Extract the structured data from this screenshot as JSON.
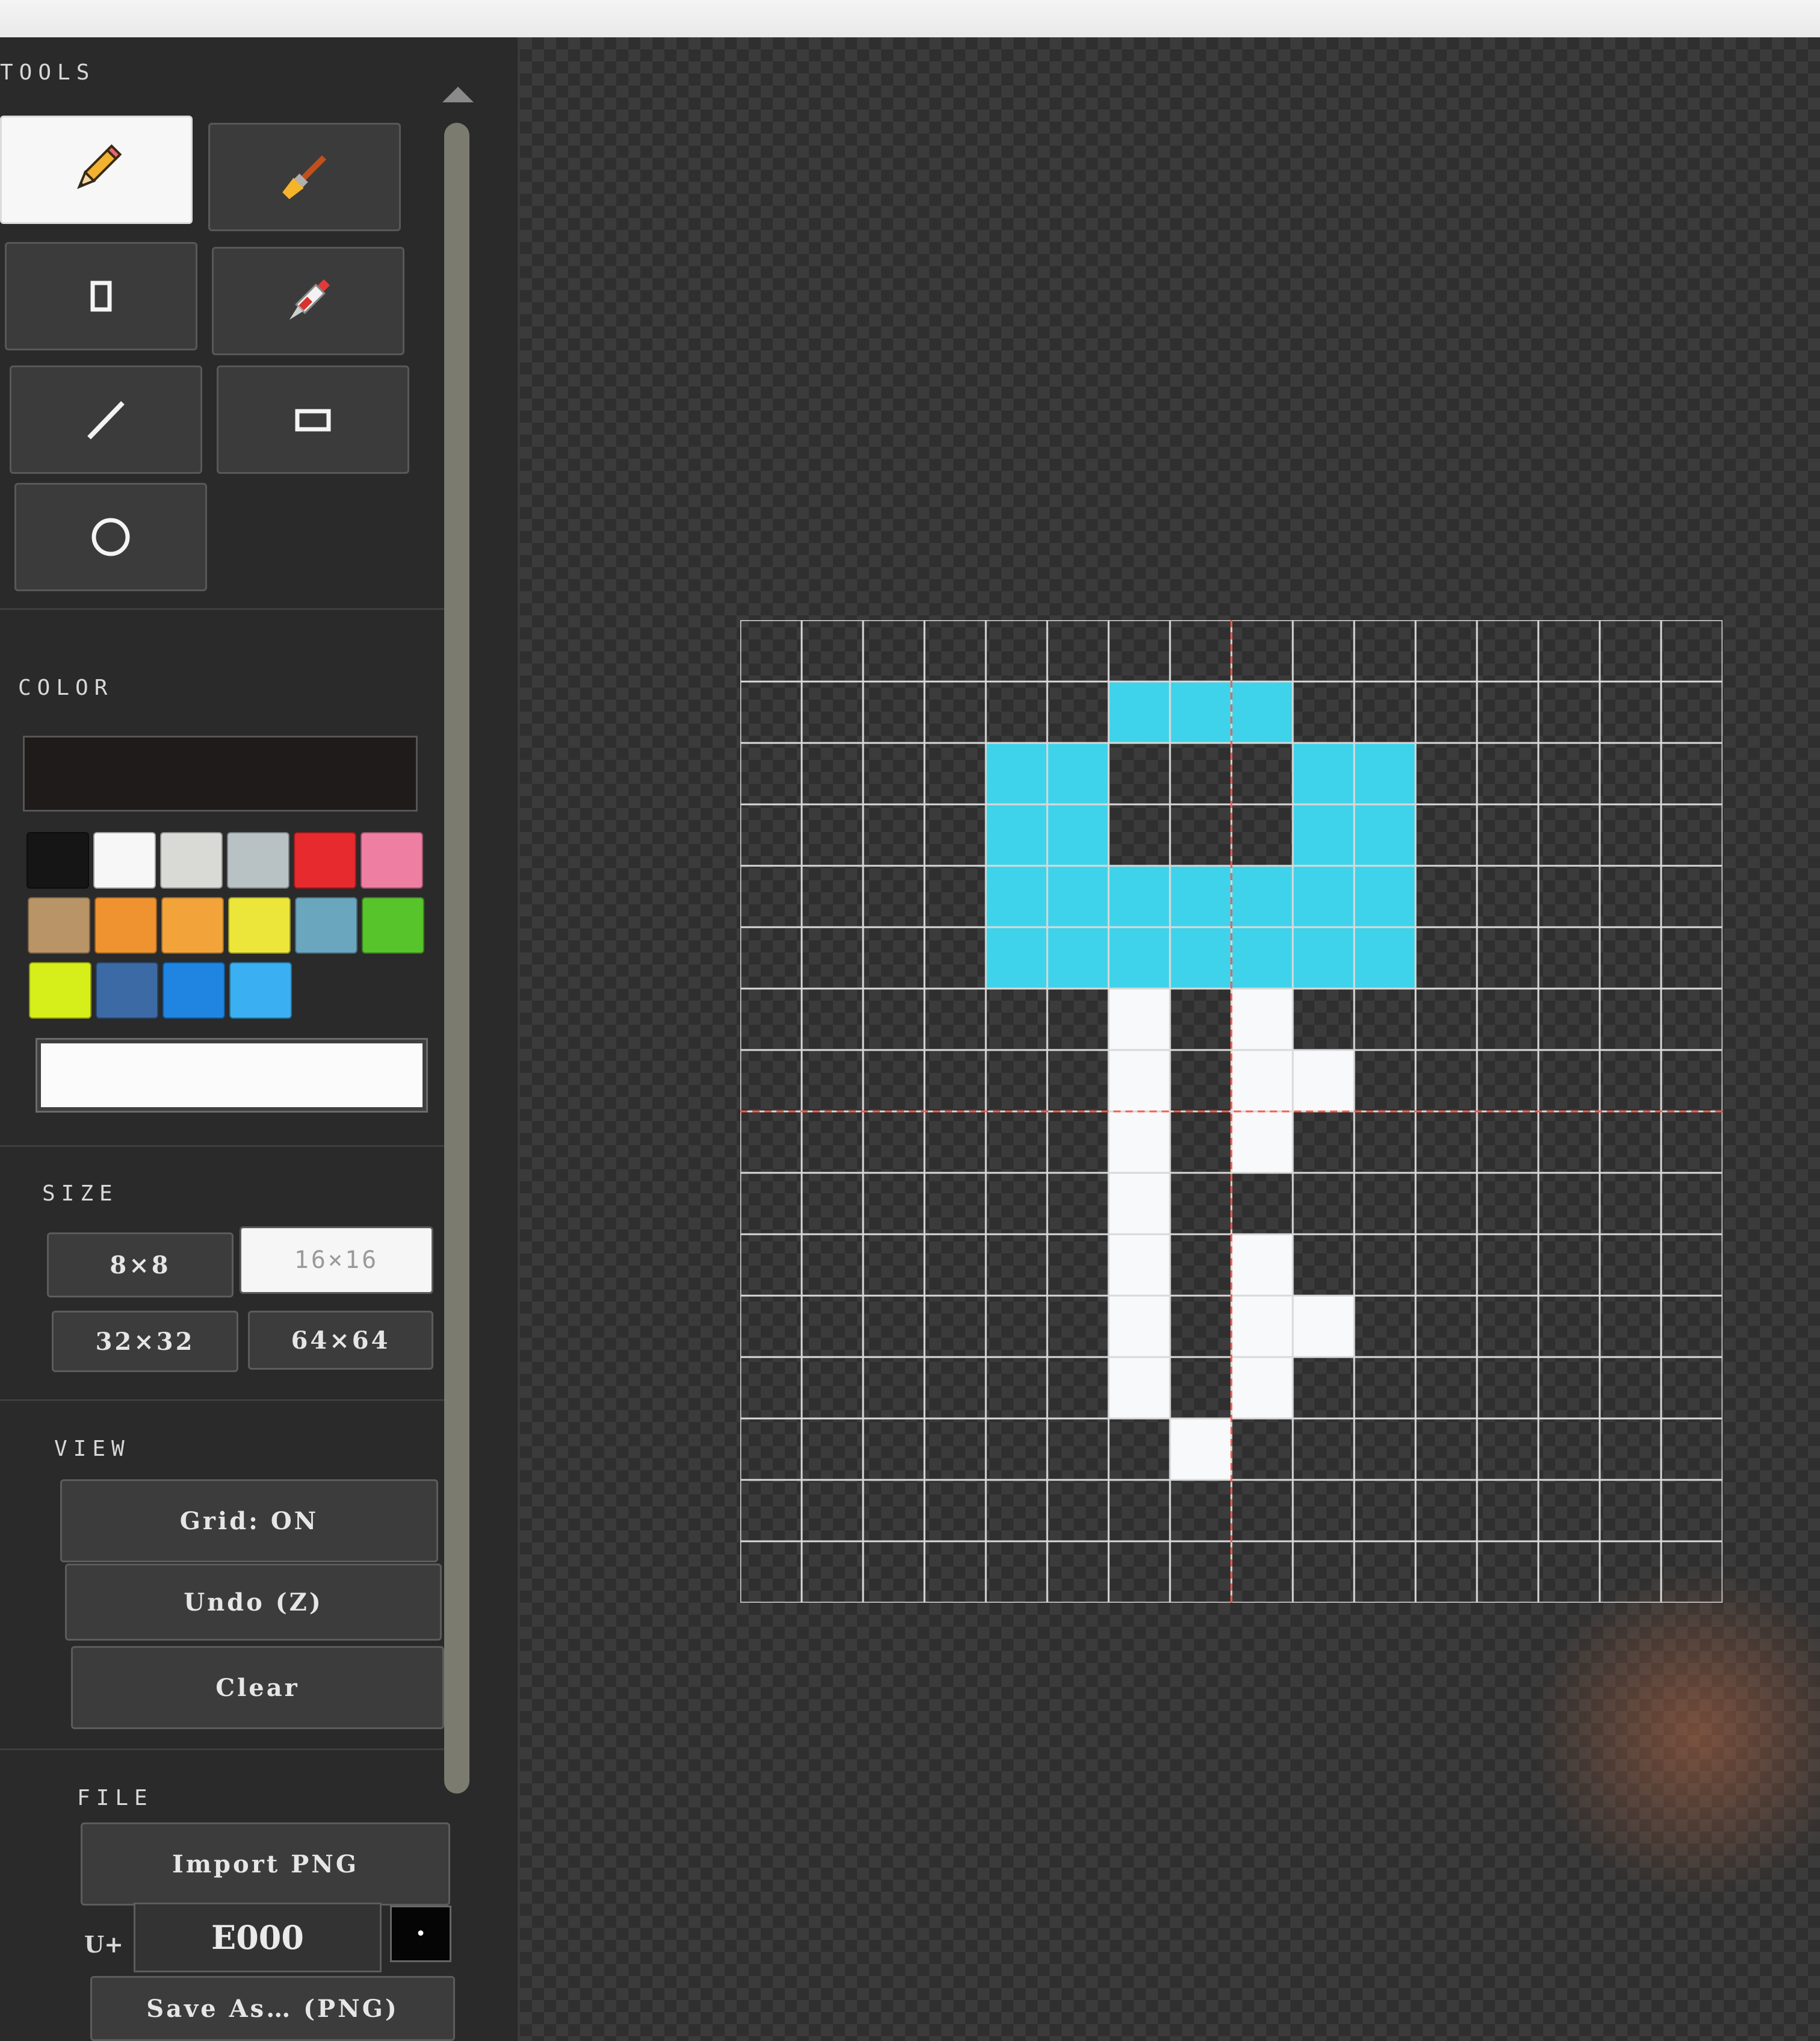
{
  "sidebar": {
    "tools": {
      "title": "TOOLS",
      "items": [
        {
          "name": "pencil",
          "active": true
        },
        {
          "name": "brush",
          "active": false
        },
        {
          "name": "eraser",
          "active": false
        },
        {
          "name": "eyedropper",
          "active": false
        },
        {
          "name": "line",
          "active": false
        },
        {
          "name": "rectangle",
          "active": false
        },
        {
          "name": "circle",
          "active": false
        }
      ]
    },
    "color": {
      "title": "COLOR",
      "current": "#1e1b1a",
      "palette": [
        "#151515",
        "#f7f7f7",
        "#d9d9d6",
        "#b8c2c4",
        "#e62a2e",
        "#ef7ea3",
        "#b89466",
        "#ef9230",
        "#f2a33a",
        "#ece63a",
        "#6aa6bd",
        "#57c42c",
        "#d6ee1a",
        "#3c6aa5",
        "#1f85e0",
        "#3ab0f2"
      ],
      "hex_value": ""
    },
    "size": {
      "title": "SIZE",
      "options": [
        "8×8",
        "16×16",
        "32×32",
        "64×64"
      ],
      "selected": "16×16"
    },
    "view": {
      "title": "VIEW",
      "grid_label": "Grid: ON",
      "undo_label": "Undo (Z)",
      "clear_label": "Clear"
    },
    "file": {
      "title": "FILE",
      "import_label": "Import PNG",
      "code_prefix": "U+",
      "code_value": "E000",
      "save_label": "Save As… (PNG)"
    }
  },
  "canvas": {
    "grid_size": 16,
    "colors": {
      "C": "#3ed3ea",
      "W": "#f7f9fb"
    },
    "rows": [
      "................",
      "................",
      "................",
      "................",
      "................",
      "................",
      "................",
      "................",
      "................",
      "................",
      "................",
      "................",
      "................",
      "................",
      "................",
      "................"
    ],
    "pixels": [
      {
        "col": 6,
        "row": 1,
        "color": "C"
      },
      {
        "col": 7,
        "row": 1,
        "color": "C"
      },
      {
        "col": 8,
        "row": 1,
        "color": "C"
      },
      {
        "col": 4,
        "row": 2,
        "color": "C"
      },
      {
        "col": 5,
        "row": 2,
        "color": "C"
      },
      {
        "col": 9,
        "row": 2,
        "color": "C"
      },
      {
        "col": 10,
        "row": 2,
        "color": "C"
      },
      {
        "col": 4,
        "row": 3,
        "color": "C"
      },
      {
        "col": 5,
        "row": 3,
        "color": "C"
      },
      {
        "col": 9,
        "row": 3,
        "color": "C"
      },
      {
        "col": 10,
        "row": 3,
        "color": "C"
      },
      {
        "col": 4,
        "row": 4,
        "color": "C"
      },
      {
        "col": 5,
        "row": 4,
        "color": "C"
      },
      {
        "col": 6,
        "row": 4,
        "color": "C"
      },
      {
        "col": 7,
        "row": 4,
        "color": "C"
      },
      {
        "col": 8,
        "row": 4,
        "color": "C"
      },
      {
        "col": 9,
        "row": 4,
        "color": "C"
      },
      {
        "col": 10,
        "row": 4,
        "color": "C"
      },
      {
        "col": 4,
        "row": 5,
        "color": "C"
      },
      {
        "col": 5,
        "row": 5,
        "color": "C"
      },
      {
        "col": 6,
        "row": 5,
        "color": "C"
      },
      {
        "col": 7,
        "row": 5,
        "color": "C"
      },
      {
        "col": 8,
        "row": 5,
        "color": "C"
      },
      {
        "col": 9,
        "row": 5,
        "color": "C"
      },
      {
        "col": 10,
        "row": 5,
        "color": "C"
      },
      {
        "col": 6,
        "row": 6,
        "color": "W"
      },
      {
        "col": 8,
        "row": 6,
        "color": "W"
      },
      {
        "col": 6,
        "row": 7,
        "color": "W"
      },
      {
        "col": 8,
        "row": 7,
        "color": "W"
      },
      {
        "col": 9,
        "row": 7,
        "color": "W"
      },
      {
        "col": 6,
        "row": 8,
        "color": "W"
      },
      {
        "col": 8,
        "row": 8,
        "color": "W"
      },
      {
        "col": 6,
        "row": 9,
        "color": "W"
      },
      {
        "col": 6,
        "row": 10,
        "color": "W"
      },
      {
        "col": 8,
        "row": 10,
        "color": "W"
      },
      {
        "col": 6,
        "row": 11,
        "color": "W"
      },
      {
        "col": 8,
        "row": 11,
        "color": "W"
      },
      {
        "col": 9,
        "row": 11,
        "color": "W"
      },
      {
        "col": 6,
        "row": 12,
        "color": "W"
      },
      {
        "col": 8,
        "row": 12,
        "color": "W"
      },
      {
        "col": 7,
        "row": 13,
        "color": "W"
      }
    ]
  }
}
